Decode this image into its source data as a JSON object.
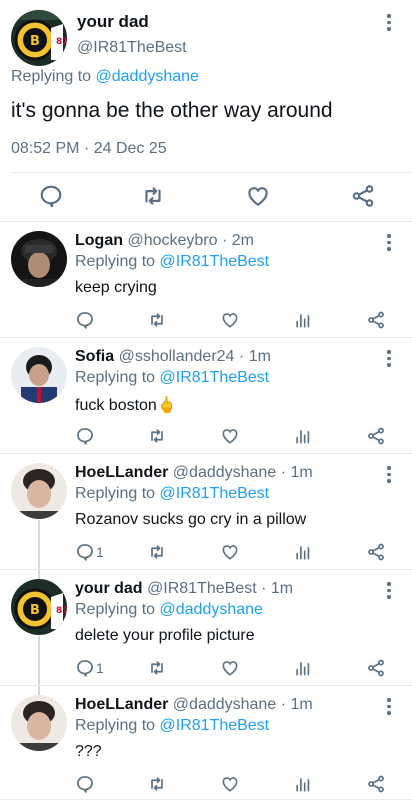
{
  "main_tweet": {
    "name": "your dad",
    "handle": "@IR81TheBest",
    "replying_prefix": "Replying to",
    "replying_to": "@daddyshane",
    "text": "it's gonna be the other way around",
    "time": "08:52 PM",
    "dot": "·",
    "date": "24 Dec 25"
  },
  "replies": [
    {
      "name": "Logan",
      "handle": "@hockeybro",
      "dot": "·",
      "time": "2m",
      "replying_prefix": "Replying to",
      "replying_to": "@IR81TheBest",
      "text": "keep crying",
      "reply_count": ""
    },
    {
      "name": "Sofia",
      "handle": "@sshollander24",
      "dot": "·",
      "time": "1m",
      "replying_prefix": "Replying to",
      "replying_to": "@IR81TheBest",
      "text": "fuck boston",
      "emoji": "🖕",
      "reply_count": ""
    },
    {
      "name": "HoeLLander",
      "handle": "@daddyshane",
      "dot": "·",
      "time": "1m",
      "replying_prefix": "Replying to",
      "replying_to": "@IR81TheBest",
      "text": "Rozanov sucks go cry in a pillow",
      "reply_count": "1"
    },
    {
      "name": "your dad",
      "handle": "@IR81TheBest",
      "dot": "·",
      "time": "1m",
      "replying_prefix": "Replying to",
      "replying_to": "@daddyshane",
      "text": "delete your profile picture",
      "reply_count": "1"
    },
    {
      "name": "HoeLLander",
      "handle": "@daddyshane",
      "dot": "·",
      "time": "1m",
      "replying_prefix": "Replying to",
      "replying_to": "@IR81TheBest",
      "text": "???",
      "reply_count": ""
    }
  ],
  "colors": {
    "link": "#1da1f2",
    "muted": "#5b7083",
    "text": "#0f1419",
    "divider": "#e6ecf0"
  },
  "icons": [
    "comment-icon",
    "retweet-icon",
    "like-icon",
    "share-icon",
    "analytics-icon",
    "more-icon"
  ]
}
